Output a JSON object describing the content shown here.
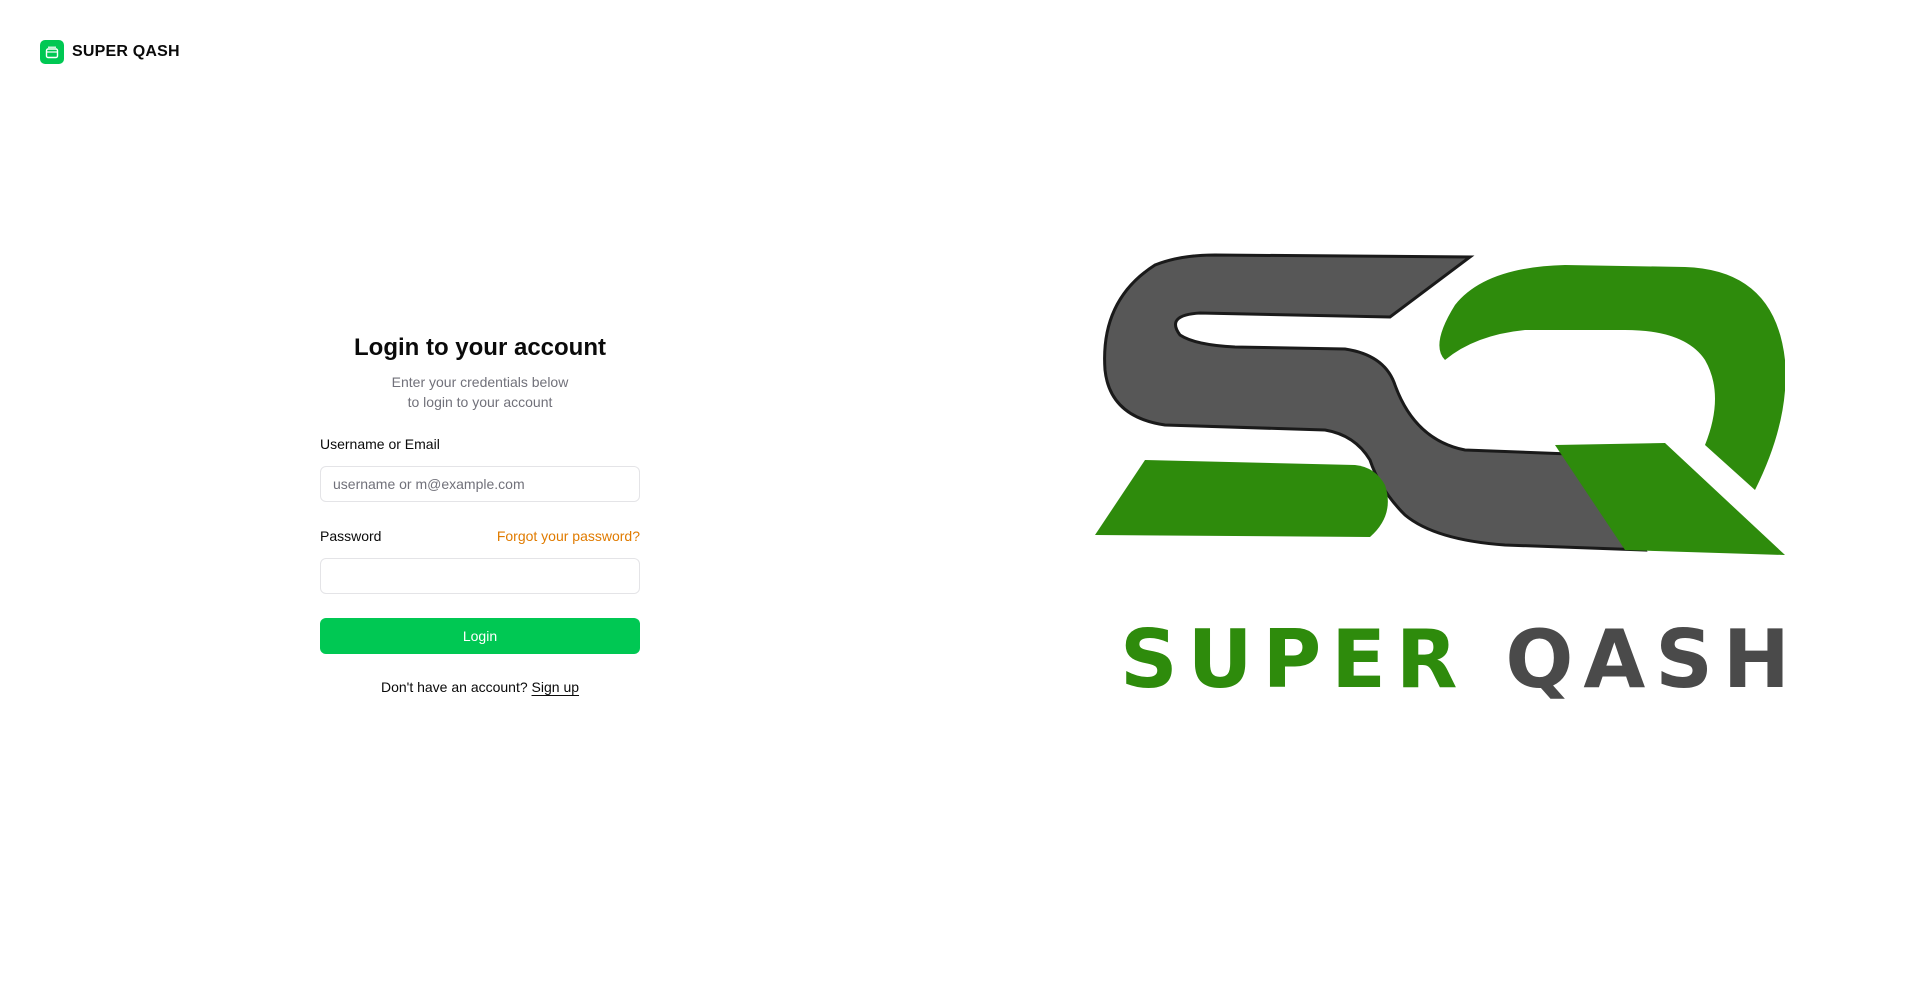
{
  "brand": {
    "name": "SUPER QASH",
    "icon": "wallet-icon",
    "accent": "#00c853"
  },
  "login": {
    "title": "Login to your account",
    "subtitle_line1": "Enter your credentials below",
    "subtitle_line2": "to login to your account",
    "username_label": "Username or Email",
    "username_placeholder": "username or m@example.com",
    "username_value": "",
    "password_label": "Password",
    "forgot_label": "Forgot your password?",
    "password_value": "",
    "submit_label": "Login",
    "signup_prompt": "Don't have an account?",
    "signup_label": "Sign up"
  },
  "logo": {
    "word1": "SUPER",
    "word2": "QASH",
    "green": "#2e8b0c",
    "gray": "#4a4a4a"
  }
}
